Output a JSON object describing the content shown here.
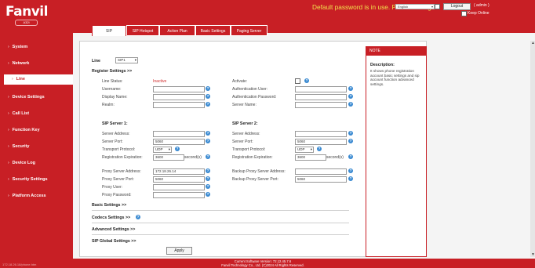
{
  "header": {
    "logo": "Fanvil",
    "model": "A32i",
    "banner": "Default password is in use. Please change",
    "language": "English",
    "logout_label": "Logout",
    "user": "( admin )",
    "keep_online": "Keep Online"
  },
  "sidebar": {
    "items": [
      {
        "label": "System",
        "active": false
      },
      {
        "label": "Network",
        "active": false
      },
      {
        "label": "Line",
        "active": true
      },
      {
        "label": "Device Settings",
        "active": false
      },
      {
        "label": "Call List",
        "active": false
      },
      {
        "label": "Function Key",
        "active": false
      },
      {
        "label": "Security",
        "active": false
      },
      {
        "label": "Device Log",
        "active": false
      },
      {
        "label": "Security Settings",
        "active": false
      },
      {
        "label": "Platform Access",
        "active": false
      }
    ]
  },
  "tabs": [
    {
      "label": "SIP",
      "active": true
    },
    {
      "label": "SIP Hotspot",
      "active": false
    },
    {
      "label": "Action Plan",
      "active": false
    },
    {
      "label": "Basic Settings",
      "active": false
    },
    {
      "label": "Paging Server",
      "active": false
    }
  ],
  "line": {
    "label": "Line",
    "value": "SIP1"
  },
  "register": {
    "title": "Register Settings >>",
    "line_status_label": "Line Status:",
    "line_status_value": "Inactive",
    "username_label": "Username:",
    "display_name_label": "Display Name:",
    "realm_label": "Realm:",
    "activate_label": "Activate:",
    "auth_user_label": "Authentication User:",
    "auth_password_label": "Authentication Password:",
    "server_name_label": "Server Name:"
  },
  "sip_server_1": {
    "title": "SIP Server 1:",
    "address_label": "Server Address:",
    "port_label": "Server Port:",
    "port_value": "5060",
    "transport_label": "Transport Protocol:",
    "transport_value": "UDP",
    "expiration_label": "Registration Expiration:",
    "expiration_value": "3600",
    "seconds_label": "second(s)"
  },
  "sip_server_2": {
    "title": "SIP Server 2:",
    "address_label": "Server Address:",
    "port_label": "Server Port:",
    "port_value": "5060",
    "transport_label": "Transport Protocol:",
    "transport_value": "UDP",
    "expiration_label": "Registration Expiration:",
    "expiration_value": "3600",
    "seconds_label": "second(s)"
  },
  "proxy": {
    "address_label": "Proxy Server Address:",
    "address_value": "172.18.26.14",
    "port_label": "Proxy Server Port:",
    "port_value": "5060",
    "user_label": "Proxy User:",
    "password_label": "Proxy Password:",
    "backup_address_label": "Backup Proxy Server Address:",
    "backup_port_label": "Backup Proxy Server Port:",
    "backup_port_value": "5060"
  },
  "sections": {
    "basic": "Basic Settings >>",
    "codecs": "Codecs Settings >>",
    "advanced": "Advanced Settings >>",
    "sip_global": "SIP Global Settings >>"
  },
  "apply_label": "Apply",
  "note": {
    "header": "NOTE",
    "title": "Description:",
    "text": "It shows phone registration account basic settings and sip account function advanced settings."
  },
  "footer": {
    "version": "Current Software Version: 72.12.45.7.6",
    "copyright": "Fanvil Technology Co., Ltd. (C)2024 All Rights Reserved.",
    "status_url": "172.18.26.18/phone.htm"
  },
  "colors": {
    "brand": "#c81f25",
    "banner": "#f2e14c",
    "info": "#3a8ad1",
    "inactive": "#d02b2b"
  },
  "icons": [
    "info-icon",
    "chevron-right-icon",
    "dropdown-arrow-icon"
  ]
}
